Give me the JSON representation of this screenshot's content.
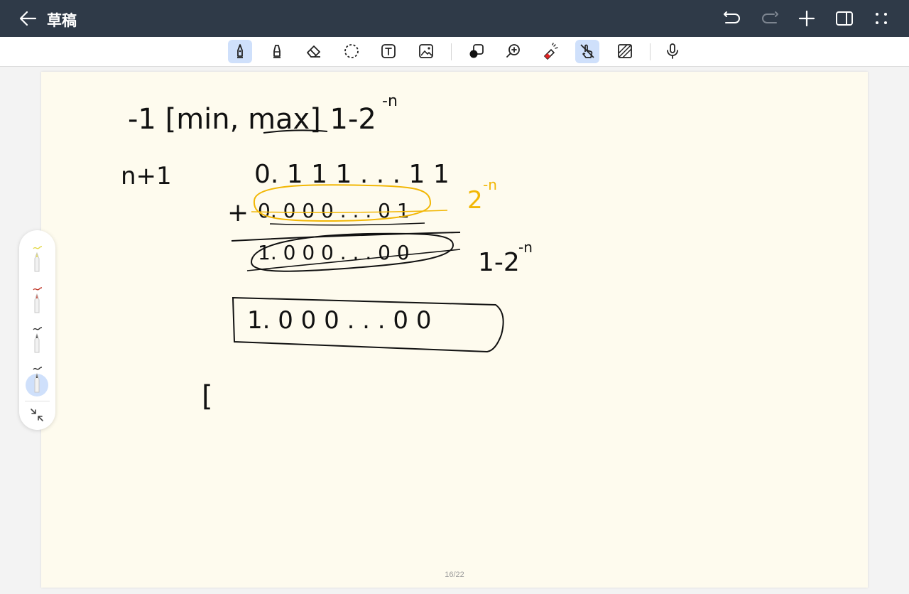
{
  "titlebar": {
    "title": "草稿",
    "icons": [
      "back-arrow-icon",
      "undo-icon",
      "redo-icon",
      "plus-icon",
      "sidebar-icon",
      "more-dots-icon"
    ]
  },
  "toolbar": {
    "tools": [
      "fountain-pen",
      "highlighter",
      "eraser",
      "lasso-select",
      "text-box",
      "image",
      "shape",
      "zoom",
      "laser-pointer",
      "finger-draw",
      "pattern",
      "microphone"
    ],
    "active_tools": [
      "fountain-pen",
      "finger-draw"
    ],
    "accent": "#cfe0fb"
  },
  "canvas": {
    "background": "#fefbee",
    "page_number": "16/22",
    "handwriting": {
      "line1": "-1 [min, max] 1-2",
      "line1_exp": "-n",
      "label_n1": "n+1",
      "row1": "0. 1 1 1 . . . 1 1",
      "row2_plus": "+",
      "row2": "0. 0 0 0 . . . 0 1",
      "row2_note": "2",
      "row2_note_exp": "-n",
      "row3": "1. 0 0 0 . . . 0 0",
      "row3_note": "1-2",
      "row3_note_exp": "-n",
      "row4": "1. 0 0 0 . . . 0 0",
      "stray": "["
    },
    "ink_colors": {
      "black": "#111111",
      "yellow": "#f2b705"
    }
  },
  "pen_palette": {
    "pens": [
      {
        "name": "pen-yellow",
        "color": "#e3d94a"
      },
      {
        "name": "pen-red",
        "color": "#c0392b"
      },
      {
        "name": "pen-black",
        "color": "#333333"
      },
      {
        "name": "pen-black-selected",
        "color": "#333333"
      }
    ],
    "selected_index": 3
  }
}
